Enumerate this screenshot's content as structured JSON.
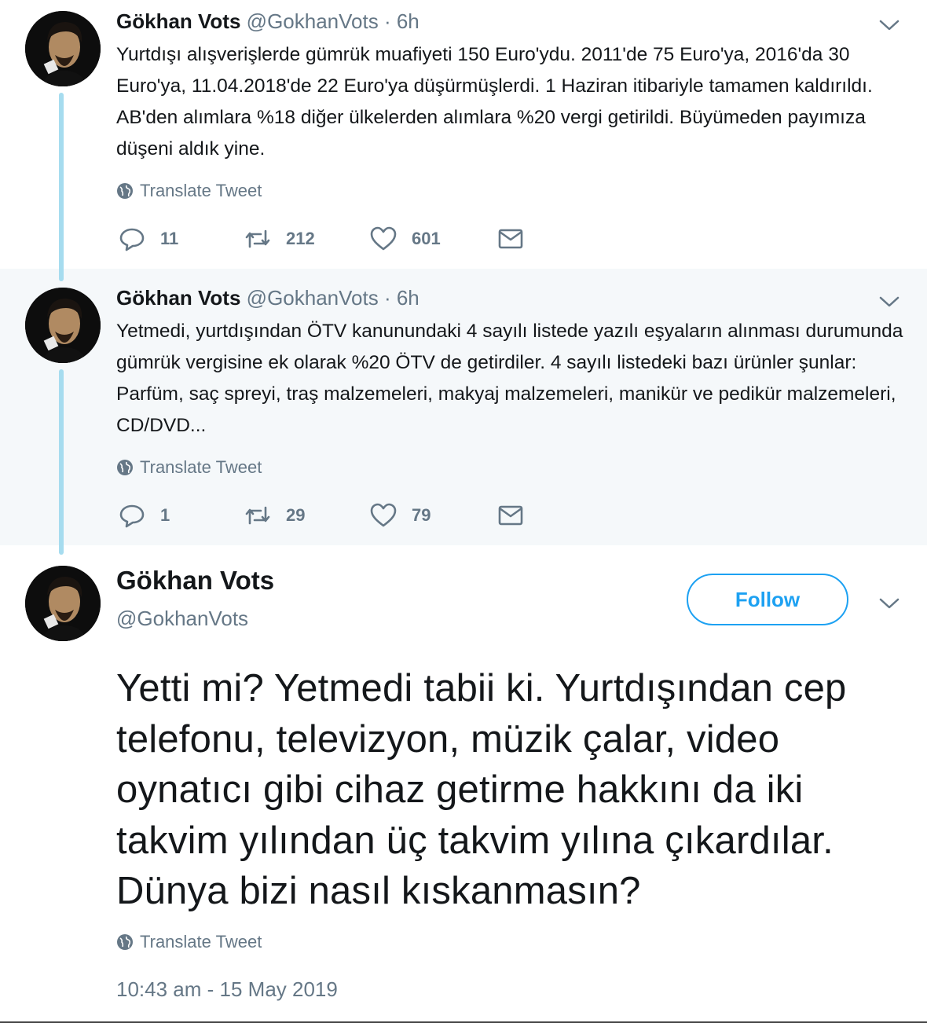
{
  "tweets": [
    {
      "author_name": "Gökhan Vots",
      "handle": "@GokhanVots",
      "time": "· 6h",
      "text": "Yurtdışı alışverişlerde gümrük muafiyeti 150 Euro'ydu. 2011'de 75 Euro'ya, 2016'da 30 Euro'ya, 11.04.2018'de 22 Euro'ya düşürmüşlerdi. 1 Haziran itibariyle tamamen kaldırıldı. AB'den alımlara %18 diğer ülkelerden alımlara %20 vergi getirildi. Büyümeden payımıza düşeni aldık yine.",
      "translate_label": "Translate Tweet",
      "replies": "11",
      "retweets": "212",
      "likes": "601"
    },
    {
      "author_name": "Gökhan Vots",
      "handle": "@GokhanVots",
      "time": "· 6h",
      "text": "Yetmedi, yurtdışından ÖTV kanunundaki 4 sayılı listede yazılı eşyaların alınması durumunda gümrük vergisine ek olarak %20 ÖTV de getirdiler. 4 sayılı listedeki bazı ürünler şunlar: Parfüm, saç spreyi, traş malzemeleri, makyaj malzemeleri, manikür ve pedikür malzemeleri, CD/DVD...",
      "translate_label": "Translate Tweet",
      "replies": "1",
      "retweets": "29",
      "likes": "79"
    }
  ],
  "focused_tweet": {
    "author_name": "Gökhan Vots",
    "handle": "@GokhanVots",
    "follow_label": "Follow",
    "text": "Yetti mi? Yetmedi tabii ki. Yurtdışından cep telefonu, televizyon, müzik çalar, video oynatıcı gibi cihaz getirme hakkını da iki takvim yılından üç takvim yılına çıkardılar. Dünya bizi nasıl kıskanmasın?",
    "translate_label": "Translate Tweet",
    "timestamp": "10:43 am - 15 May 2019"
  },
  "icons": {
    "reply": "reply-icon",
    "retweet": "retweet-icon",
    "like": "heart-icon",
    "dm": "envelope-icon",
    "translate": "globe-icon",
    "menu": "chevron-down-icon"
  },
  "colors": {
    "accent": "#1da1f2",
    "muted": "#657786",
    "thread_line": "#a6dcef",
    "highlight_bg": "#f5f8fa"
  }
}
